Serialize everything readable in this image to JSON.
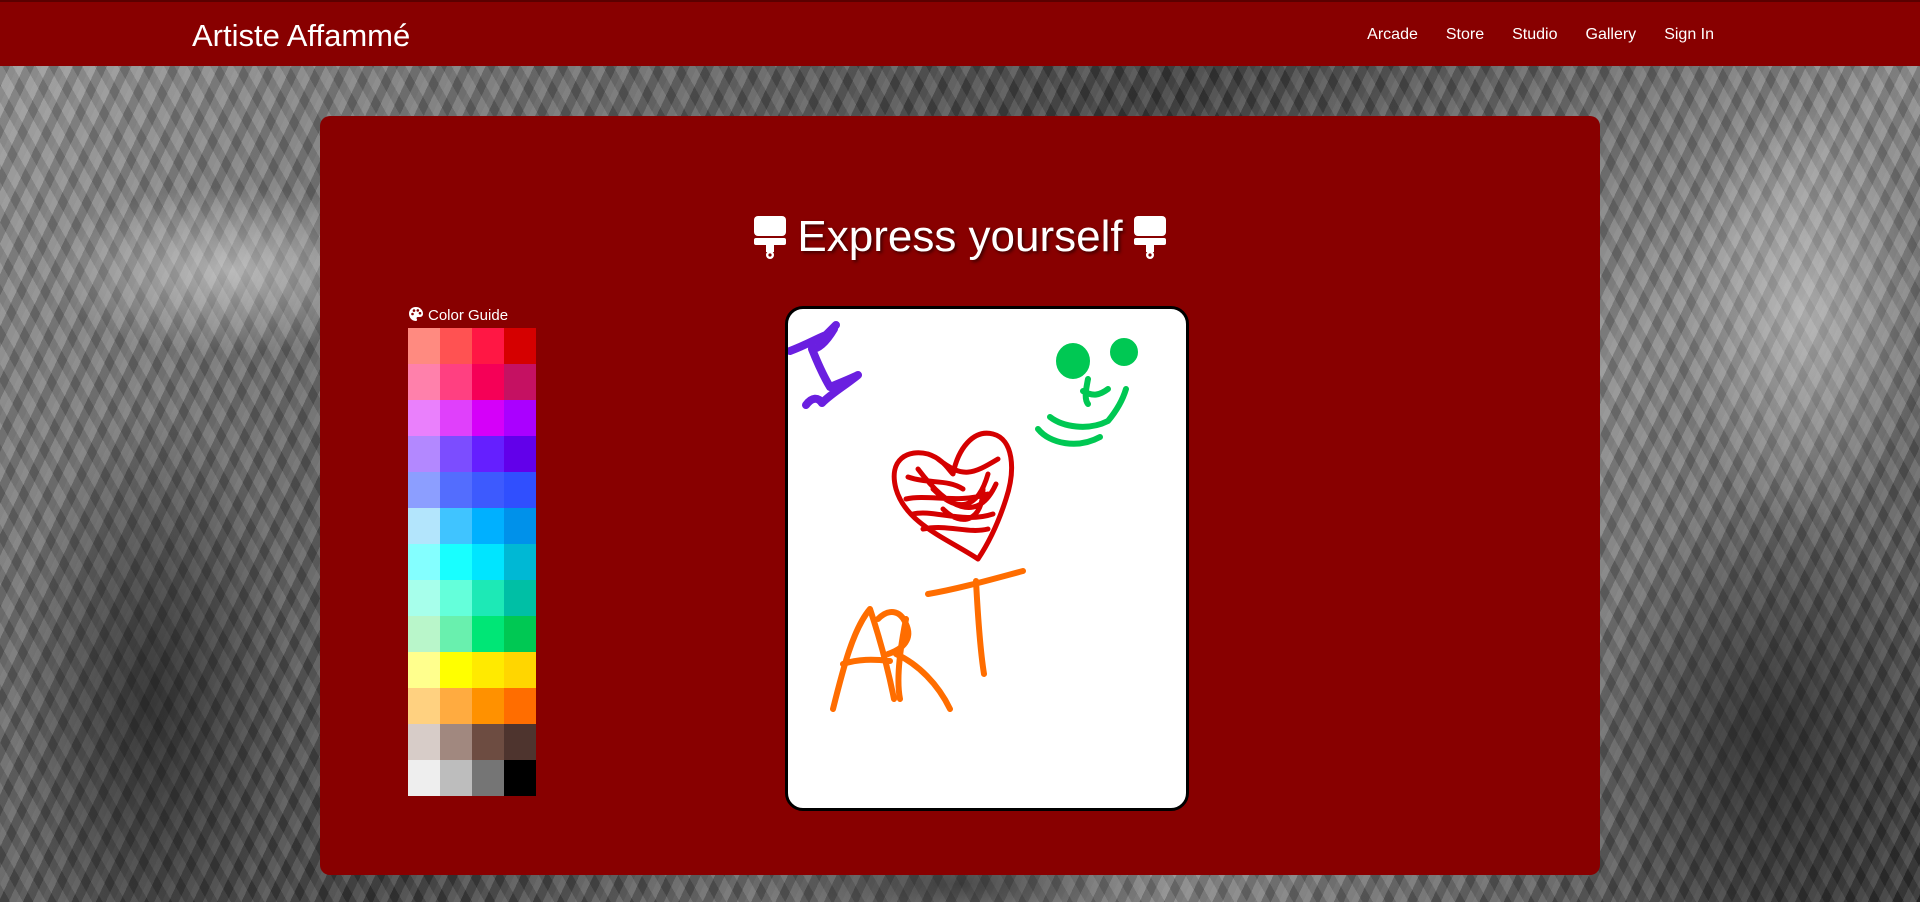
{
  "navbar": {
    "brand": "Artiste Affammé",
    "links": [
      "Arcade",
      "Store",
      "Studio",
      "Gallery",
      "Sign In"
    ]
  },
  "main": {
    "heading": "Express yourself",
    "heading_icon": "paint-roller-icon"
  },
  "color_guide": {
    "title": "Color Guide",
    "icon": "palette-icon",
    "swatches": [
      "#ff8a80",
      "#ff5252",
      "#ff1744",
      "#d50000",
      "#ff80ab",
      "#ff4081",
      "#f50057",
      "#c51162",
      "#ea80fc",
      "#e040fb",
      "#d500f9",
      "#aa00ff",
      "#b388ff",
      "#7c4dff",
      "#651fff",
      "#6200ea",
      "#8c9eff",
      "#536dfe",
      "#3d5afe",
      "#304ffe",
      "#b3e5fc",
      "#40c4ff",
      "#00b0ff",
      "#0091ea",
      "#84ffff",
      "#18ffff",
      "#00e5ff",
      "#00b8d4",
      "#a7ffeb",
      "#64ffda",
      "#1de9b6",
      "#00bfa5",
      "#b9f6ca",
      "#69f0ae",
      "#00e676",
      "#00c853",
      "#ffff8d",
      "#ffff00",
      "#ffea00",
      "#ffd600",
      "#ffd180",
      "#ffab40",
      "#ff9100",
      "#ff6d00",
      "#d7ccc8",
      "#a1887f",
      "#6d4c41",
      "#4e342e",
      "#eeeeee",
      "#bdbdbd",
      "#757575",
      "#000000"
    ]
  },
  "canvas": {
    "drawing": [
      "I",
      "heart",
      "ART",
      "smiley"
    ],
    "stroke_colors": {
      "letter_i": "#6a1fe0",
      "heart": "#d50000",
      "art": "#ff6d00",
      "smiley": "#00c853"
    }
  },
  "theme": {
    "primary": "#880000"
  }
}
